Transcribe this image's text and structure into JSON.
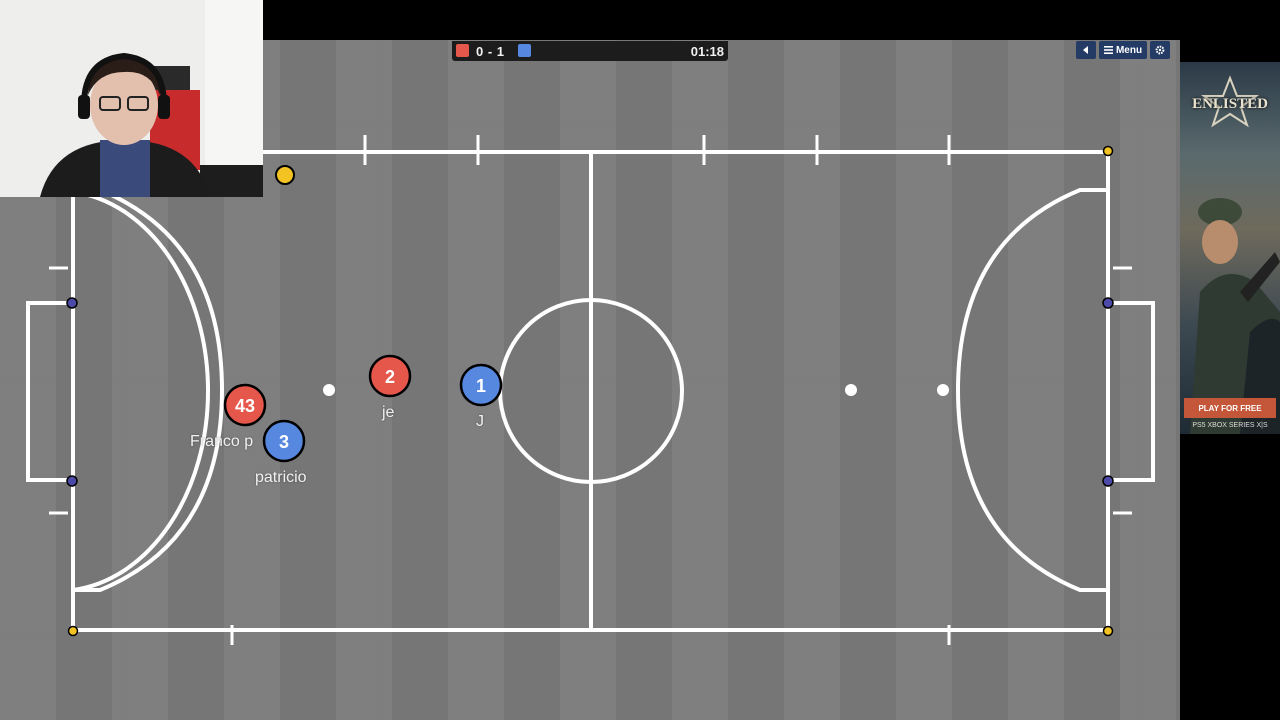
{
  "hud": {
    "score": "0 - 1",
    "timer": "01:18",
    "menu_label": "Menu",
    "team_colors": {
      "red": "#e5574a",
      "blue": "#5688e0"
    }
  },
  "players": [
    {
      "team": "red",
      "number": "43",
      "name": "Franco p"
    },
    {
      "team": "red",
      "number": "2",
      "name": "je"
    },
    {
      "team": "blue",
      "number": "1",
      "name": "J"
    },
    {
      "team": "blue",
      "number": "3",
      "name": "patricio"
    }
  ],
  "ball_color": "#f2c322",
  "ad": {
    "brand": "ENLISTED",
    "cta": "PLAY FOR FREE",
    "platforms": "PS5  XBOX SERIES X|S"
  }
}
